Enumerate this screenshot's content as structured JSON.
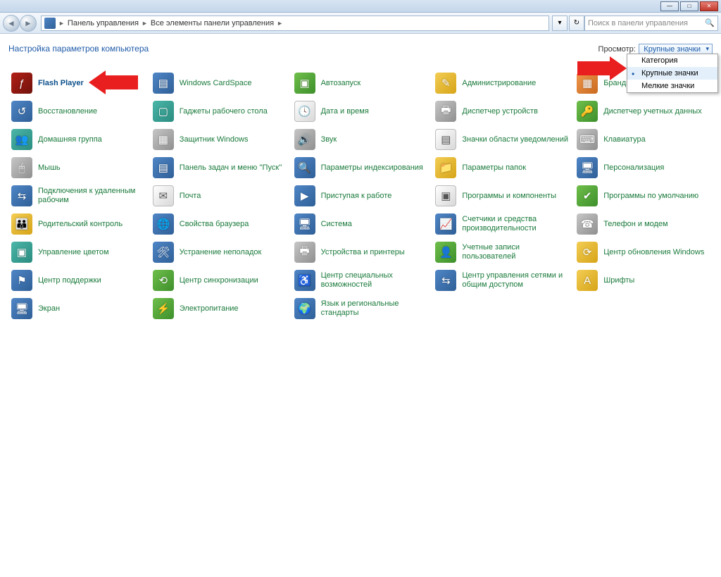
{
  "titlebar": {
    "min": "—",
    "max": "□",
    "close": "✕"
  },
  "nav": {
    "back": "◄",
    "fwd": "►",
    "crumb1": "Панель управления",
    "crumb2": "Все элементы панели управления",
    "sep": "►",
    "refresh": "↻",
    "dropdown": "▾"
  },
  "search": {
    "placeholder": "Поиск в панели управления",
    "glyph": "🔍"
  },
  "header": {
    "title": "Настройка параметров компьютера",
    "view_label": "Просмотр:",
    "view_value": "Крупные значки"
  },
  "view_menu": {
    "opt_category": "Категория",
    "opt_large": "Крупные значки",
    "opt_small": "Мелкие значки"
  },
  "items": [
    {
      "label": "Flash Player",
      "ic": "ic-red",
      "g": "ƒ",
      "hl": true
    },
    {
      "label": "Windows CardSpace",
      "ic": "ic-blue",
      "g": "▤"
    },
    {
      "label": "Автозапуск",
      "ic": "ic-green",
      "g": "▣"
    },
    {
      "label": "Администрирование",
      "ic": "ic-yellow",
      "g": "✎"
    },
    {
      "label": "Брандмауэр Windows",
      "ic": "ic-orange",
      "g": "▦"
    },
    {
      "label": "Восстановление",
      "ic": "ic-blue",
      "g": "↺"
    },
    {
      "label": "Гаджеты рабочего стола",
      "ic": "ic-teal",
      "g": "▢"
    },
    {
      "label": "Дата и время",
      "ic": "ic-white",
      "g": "🕓"
    },
    {
      "label": "Диспетчер устройств",
      "ic": "ic-gray",
      "g": "🖶"
    },
    {
      "label": "Диспетчер учетных данных",
      "ic": "ic-green",
      "g": "🔑"
    },
    {
      "label": "Домашняя группа",
      "ic": "ic-teal",
      "g": "👥"
    },
    {
      "label": "Защитник Windows",
      "ic": "ic-gray",
      "g": "▦"
    },
    {
      "label": "Звук",
      "ic": "ic-gray",
      "g": "🔊"
    },
    {
      "label": "Значки области уведомлений",
      "ic": "ic-white",
      "g": "▤"
    },
    {
      "label": "Клавиатура",
      "ic": "ic-gray",
      "g": "⌨"
    },
    {
      "label": "Мышь",
      "ic": "ic-gray",
      "g": "🖱"
    },
    {
      "label": "Панель задач и меню ''Пуск''",
      "ic": "ic-blue",
      "g": "▤"
    },
    {
      "label": "Параметры индексирования",
      "ic": "ic-blue",
      "g": "🔍"
    },
    {
      "label": "Параметры папок",
      "ic": "ic-yellow",
      "g": "📁"
    },
    {
      "label": "Персонализация",
      "ic": "ic-blue",
      "g": "🖥"
    },
    {
      "label": "Подключения к удаленным рабочим",
      "ic": "ic-blue",
      "g": "⇆"
    },
    {
      "label": "Почта",
      "ic": "ic-white",
      "g": "✉"
    },
    {
      "label": "Приступая к работе",
      "ic": "ic-blue",
      "g": "▶"
    },
    {
      "label": "Программы и компоненты",
      "ic": "ic-white",
      "g": "▣"
    },
    {
      "label": "Программы по умолчанию",
      "ic": "ic-green",
      "g": "✔"
    },
    {
      "label": "Родительский контроль",
      "ic": "ic-yellow",
      "g": "👪"
    },
    {
      "label": "Свойства браузера",
      "ic": "ic-blue",
      "g": "🌐"
    },
    {
      "label": "Система",
      "ic": "ic-blue",
      "g": "🖥"
    },
    {
      "label": "Счетчики и средства производительности",
      "ic": "ic-blue",
      "g": "📈"
    },
    {
      "label": "Телефон и модем",
      "ic": "ic-gray",
      "g": "☎"
    },
    {
      "label": "Управление цветом",
      "ic": "ic-teal",
      "g": "▣"
    },
    {
      "label": "Устранение неполадок",
      "ic": "ic-blue",
      "g": "🛠"
    },
    {
      "label": "Устройства и принтеры",
      "ic": "ic-gray",
      "g": "🖶"
    },
    {
      "label": "Учетные записи пользователей",
      "ic": "ic-green",
      "g": "👤"
    },
    {
      "label": "Центр обновления Windows",
      "ic": "ic-yellow",
      "g": "⟳"
    },
    {
      "label": "Центр поддержки",
      "ic": "ic-blue",
      "g": "⚑"
    },
    {
      "label": "Центр синхронизации",
      "ic": "ic-green",
      "g": "⟲"
    },
    {
      "label": "Центр специальных возможностей",
      "ic": "ic-blue",
      "g": "♿"
    },
    {
      "label": "Центр управления сетями и общим доступом",
      "ic": "ic-blue",
      "g": "⇆"
    },
    {
      "label": "Шрифты",
      "ic": "ic-yellow",
      "g": "A"
    },
    {
      "label": "Экран",
      "ic": "ic-blue",
      "g": "🖥"
    },
    {
      "label": "Электропитание",
      "ic": "ic-green",
      "g": "⚡"
    },
    {
      "label": "Язык и региональные стандарты",
      "ic": "ic-blue",
      "g": "🌍"
    }
  ]
}
